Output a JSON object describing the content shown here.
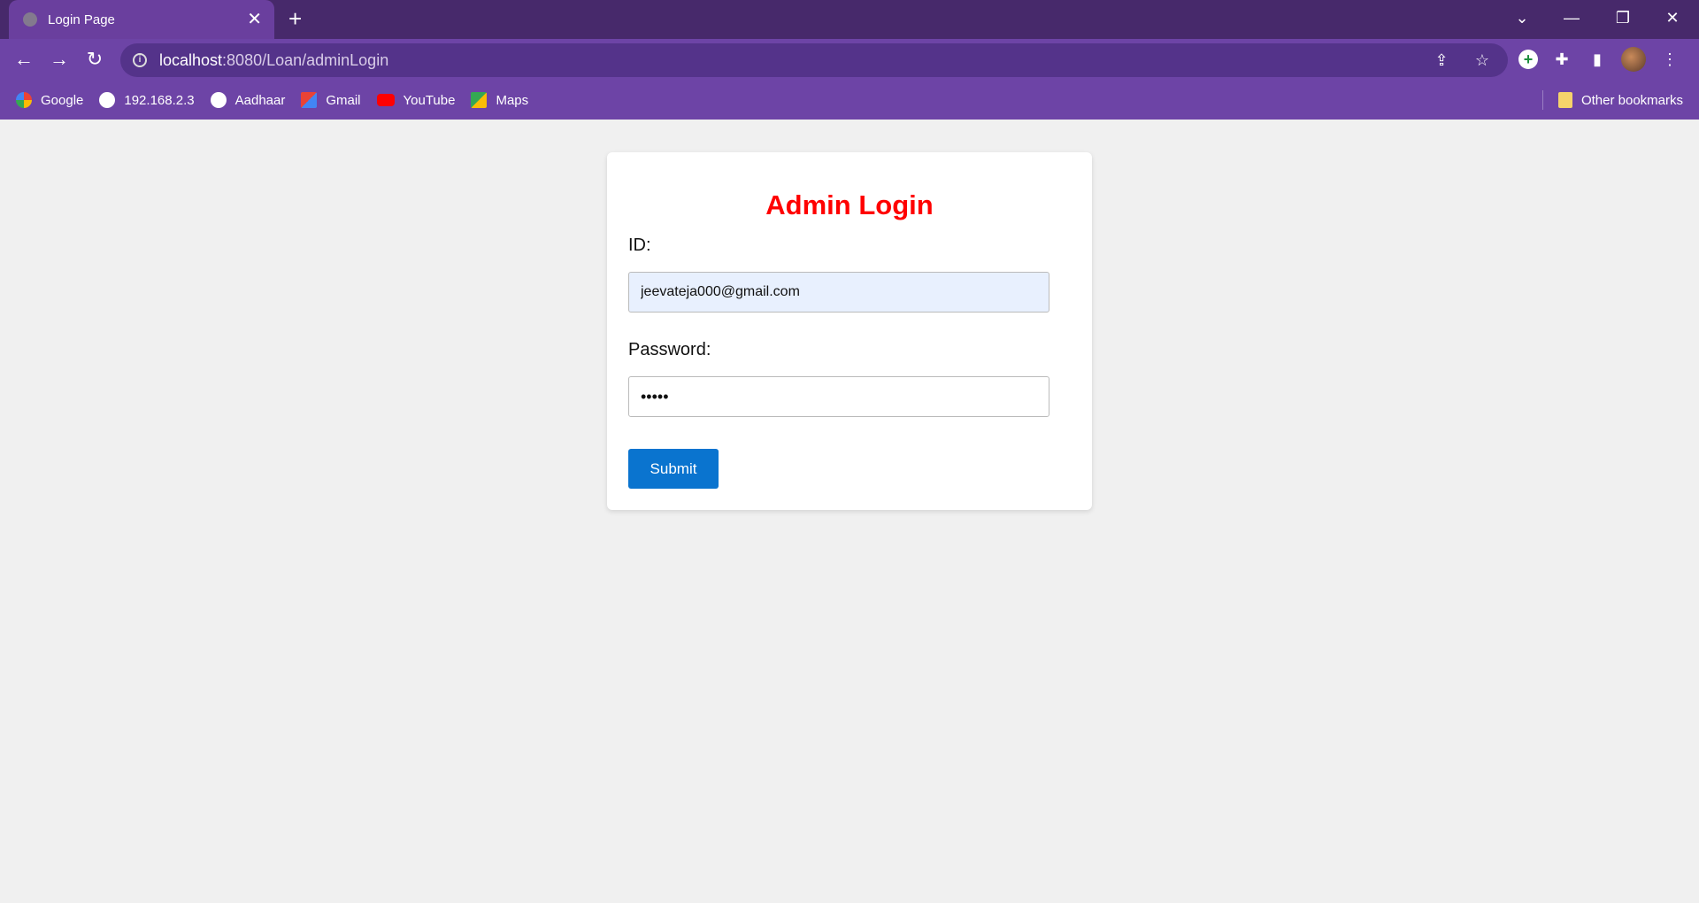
{
  "tab": {
    "title": "Login Page",
    "close": "✕",
    "new_tab": "+"
  },
  "window": {
    "tab_search": "⌄",
    "minimize": "—",
    "restore": "❐",
    "close": "✕"
  },
  "toolbar": {
    "back": "←",
    "forward": "→",
    "reload": "↻",
    "url_host": "localhost",
    "url_rest": ":8080/Loan/adminLogin",
    "share": "⇪",
    "bookmark_star": "☆",
    "add": "+",
    "extensions": "✚",
    "side_panel": "▮",
    "menu": "⋮"
  },
  "bookmarks": {
    "items": [
      {
        "label": "Google",
        "color": "#ffffff"
      },
      {
        "label": "192.168.2.3",
        "color": "#ffffff"
      },
      {
        "label": "Aadhaar",
        "color": "#ffffff"
      },
      {
        "label": "Gmail",
        "color": "#ea4335"
      },
      {
        "label": "YouTube",
        "color": "#ff0000"
      },
      {
        "label": "Maps",
        "color": "#34a853"
      }
    ],
    "other": "Other bookmarks"
  },
  "login": {
    "title": "Admin Login",
    "id_label": "ID:",
    "id_value": "jeevateja000@gmail.com",
    "password_label": "Password:",
    "password_value": "•••••",
    "submit_label": "Submit"
  }
}
